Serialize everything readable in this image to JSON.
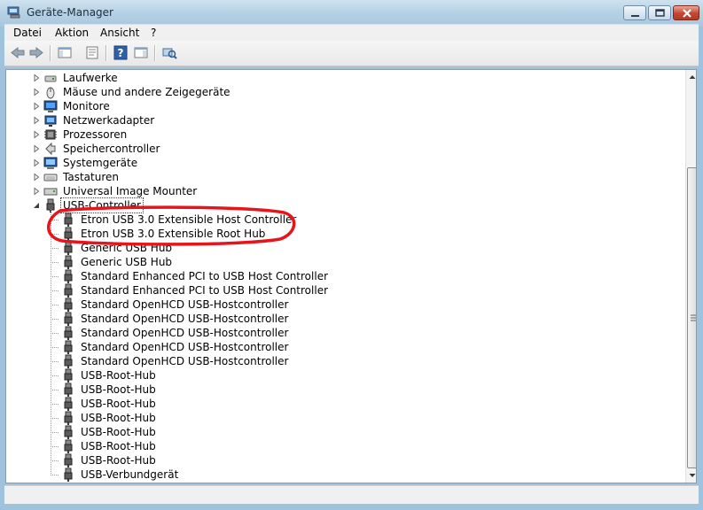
{
  "window": {
    "title": "Geräte-Manager"
  },
  "menu": {
    "items": [
      "Datei",
      "Aktion",
      "Ansicht",
      "?"
    ]
  },
  "toolbar": {
    "icons": [
      "back-arrow-icon",
      "forward-arrow-icon",
      "show-hide-console-tree-icon",
      "properties-icon",
      "help-icon",
      "action-pane-icon",
      "scan-hardware-icon"
    ]
  },
  "tree": {
    "categories": [
      {
        "label": "Laufwerke",
        "icon": "drive-icon",
        "expanded": false
      },
      {
        "label": "Mäuse und andere Zeigegeräte",
        "icon": "mouse-icon",
        "expanded": false
      },
      {
        "label": "Monitore",
        "icon": "monitor-icon",
        "expanded": false
      },
      {
        "label": "Netzwerkadapter",
        "icon": "network-adapter-icon",
        "expanded": false
      },
      {
        "label": "Prozessoren",
        "icon": "processor-icon",
        "expanded": false
      },
      {
        "label": "Speichercontroller",
        "icon": "storage-controller-icon",
        "expanded": false
      },
      {
        "label": "Systemgeräte",
        "icon": "system-device-icon",
        "expanded": false
      },
      {
        "label": "Tastaturen",
        "icon": "keyboard-icon",
        "expanded": false
      },
      {
        "label": "Universal Image Mounter",
        "icon": "image-mounter-icon",
        "expanded": false
      },
      {
        "label": "USB-Controller",
        "icon": "usb-plug-icon",
        "expanded": true,
        "selected": true
      }
    ],
    "usb_children": [
      "Etron USB 3.0 Extensible Host Controller",
      "Etron USB 3.0 Extensible Root Hub",
      "Generic USB Hub",
      "Generic USB Hub",
      "Standard Enhanced PCI to USB Host Controller",
      "Standard Enhanced PCI to USB Host Controller",
      "Standard OpenHCD USB-Hostcontroller",
      "Standard OpenHCD USB-Hostcontroller",
      "Standard OpenHCD USB-Hostcontroller",
      "Standard OpenHCD USB-Hostcontroller",
      "Standard OpenHCD USB-Hostcontroller",
      "USB-Root-Hub",
      "USB-Root-Hub",
      "USB-Root-Hub",
      "USB-Root-Hub",
      "USB-Root-Hub",
      "USB-Root-Hub",
      "USB-Root-Hub",
      "USB-Verbundgerät"
    ]
  },
  "annotation": {
    "color": "#e8141b"
  },
  "scrollbar": {
    "position_fraction": 0.38
  }
}
